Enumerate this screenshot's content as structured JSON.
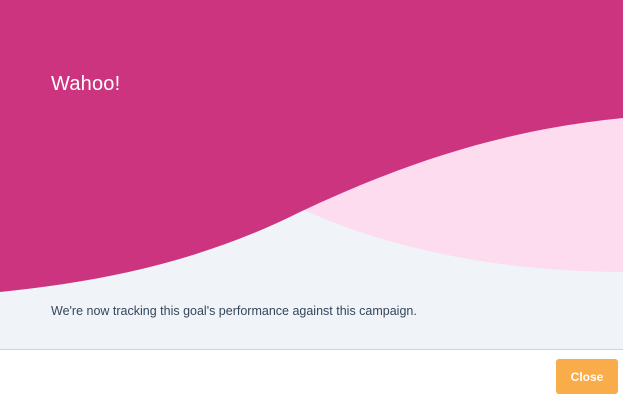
{
  "modal": {
    "title": "Wahoo!",
    "message": "We're now tracking this goal's performance against this campaign.",
    "close_label": "Close"
  },
  "colors": {
    "primary_magenta": "#cd3480",
    "light_pink": "#fddcf0",
    "hero_background": "#f0f3f8",
    "button_orange": "#f9ad4a",
    "text_dark": "#33475b"
  }
}
